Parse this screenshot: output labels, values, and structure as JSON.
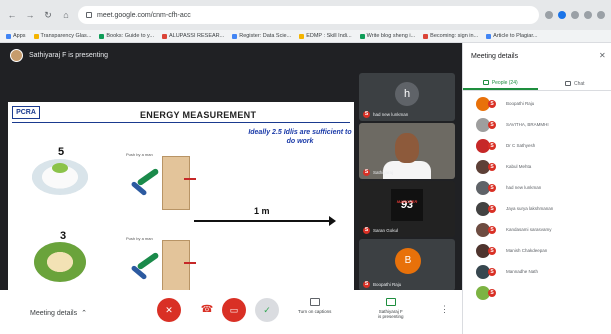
{
  "browser": {
    "url": "meet.google.com/cnm-cfh-acc",
    "bookmarks": [
      "Apps",
      "Transparency Glas...",
      "Books: Guide to y...",
      "ALUPASSI RESEAR...",
      "Register: Data Scie...",
      "EDMP : Skill Indi...",
      "Write blog sheng i...",
      "Becoming: sign in...",
      "Article to Plagiar..."
    ]
  },
  "presenter": {
    "text": "Sathiyaraj F is presenting"
  },
  "slide": {
    "logo": "PCRA",
    "title": "ENERGY MEASUREMENT",
    "note": "Ideally 2.5 Idlis are sufficient to do work",
    "count_top": "5",
    "count_bottom": "3",
    "push_label_top": "Push by a man",
    "push_label_bottom": "Push by a man",
    "distance": "1 m"
  },
  "tiles": [
    {
      "name": "had new lunkman",
      "avatar_letter": "h"
    },
    {
      "name": "Sathiyaraj"
    },
    {
      "name": "Saran Gokul",
      "jersey_number": "93",
      "jersey_text": "MARCHER"
    },
    {
      "name": "Boopathi Raju",
      "avatar_letter": "B"
    }
  ],
  "toolbar": {
    "meeting_details": "Meeting details",
    "captions_label": "Turn on captions",
    "present_label": "Sathiyaraj F\nis presenting",
    "check_icon": "✓"
  },
  "panel": {
    "title": "Meeting details",
    "tabs": [
      "People (24)",
      "Chat"
    ],
    "people": [
      {
        "name": "Boopathi Raju",
        "color": "#e8710a"
      },
      {
        "name": "SAVITHA, BRAMMHI",
        "color": "#9e9e9e"
      },
      {
        "name": "Dr C Sathyesh",
        "color": "#c62828"
      },
      {
        "name": "Kabul Mehta",
        "color": "#5d4037"
      },
      {
        "name": "had new lunkman",
        "color": "#5f6368"
      },
      {
        "name": "Jaya surya lakshmanan",
        "color": "#424242"
      },
      {
        "name": "Kandasami sarasvamy",
        "color": "#6d4c41"
      },
      {
        "name": "Manish Chakdeepan",
        "color": "#4e342e"
      },
      {
        "name": "Mannadhe Nath",
        "color": "#37474f"
      },
      {
        "name": "",
        "color": "#7cb342"
      }
    ]
  },
  "colors": {
    "mute_red": "#d93025",
    "accent_green": "#1e8e3e",
    "slide_blue": "#1a3aa8"
  }
}
